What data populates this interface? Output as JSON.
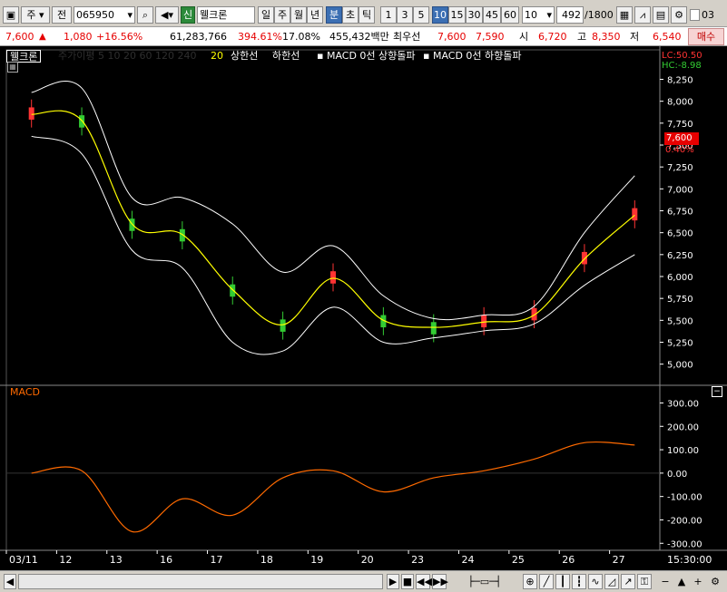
{
  "toolbar": {
    "market": "주",
    "prev_label": "전",
    "code": "065950",
    "badge": "신",
    "stock_name": "웰크론",
    "periods": [
      "일",
      "주",
      "월",
      "년",
      "분",
      "초",
      "틱"
    ],
    "active_period": "분",
    "intervals": [
      "1",
      "3",
      "5",
      "10",
      "15",
      "30",
      "45",
      "60"
    ],
    "active_interval": "10",
    "count_select": "10",
    "bar_count": "492",
    "bar_total": "/1800",
    "checkbox_label": "03"
  },
  "quote": {
    "price": "7,600",
    "change_arrow": "▲",
    "change": "1,080",
    "change_pct": "+16.56%",
    "volume": "61,283,766",
    "vol_ratio": "394.61%",
    "turnover": "17.08%",
    "amount": "455,432백만",
    "best_label": "최우선",
    "best_ask": "7,600",
    "best_bid": "7,590",
    "open_label": "시",
    "open": "6,720",
    "high_label": "고",
    "high": "8,350",
    "low_label": "저",
    "low": "6,540",
    "buy_button": "매수"
  },
  "legend": {
    "name_box": "웰크론",
    "faded_text": "주가이평 5 10 20 60 120 240",
    "ma_value": "20",
    "upper_band": "상한선",
    "lower_band": "하한선",
    "macd_up": "MACD 0선 상향돌파",
    "macd_down": "MACD 0선 하향돌파"
  },
  "price_panel": {
    "lc": "LC:50.50",
    "hc": "HC:-8.98",
    "current_price": "7,600",
    "current_pct": "0.40%",
    "y_ticks": [
      "8,250",
      "8,000",
      "7,750",
      "7,500",
      "7,250",
      "7,000",
      "6,750",
      "6,500",
      "6,250",
      "6,000",
      "5,750",
      "5,500",
      "5,250",
      "5,000"
    ]
  },
  "macd_panel": {
    "title": "MACD",
    "y_ticks": [
      "300.00",
      "200.00",
      "100.00",
      "0.00",
      "-100.00",
      "-200.00",
      "-300.00"
    ]
  },
  "x_axis": {
    "labels": [
      "03/11",
      "12",
      "13",
      "16",
      "17",
      "18",
      "19",
      "20",
      "23",
      "24",
      "25",
      "26",
      "27"
    ],
    "time": "15:30:00"
  },
  "colors": {
    "up": "#ff3333",
    "down": "#33cc33",
    "ma": "#ffff00",
    "band": "#ffffff",
    "macd": "#ff6a00"
  },
  "chart_data": [
    {
      "type": "line",
      "title": "웰크론",
      "x": [
        "03/11",
        "12",
        "13",
        "16",
        "17",
        "18",
        "19",
        "20",
        "23",
        "24",
        "25",
        "26",
        "27"
      ],
      "ylim": [
        4800,
        8400
      ],
      "series": [
        {
          "name": "20",
          "values": [
            7850,
            7780,
            6600,
            6480,
            5850,
            5450,
            5980,
            5500,
            5420,
            5480,
            5560,
            6200,
            6700
          ]
        },
        {
          "name": "상한선",
          "values": [
            8100,
            8150,
            6900,
            6900,
            6600,
            6050,
            6350,
            5780,
            5520,
            5560,
            5660,
            6500,
            7150
          ]
        },
        {
          "name": "하한선",
          "values": [
            7600,
            7400,
            6300,
            6100,
            5250,
            5150,
            5650,
            5250,
            5300,
            5380,
            5460,
            5900,
            6250
          ]
        }
      ]
    },
    {
      "type": "line",
      "title": "MACD",
      "x": [
        "03/11",
        "12",
        "13",
        "16",
        "17",
        "18",
        "19",
        "20",
        "23",
        "24",
        "25",
        "26",
        "27"
      ],
      "ylim": [
        -330,
        360
      ],
      "series": [
        {
          "name": "MACD",
          "values": [
            0,
            10,
            -250,
            -110,
            -180,
            -20,
            10,
            -80,
            -20,
            10,
            60,
            130,
            120
          ]
        }
      ]
    }
  ]
}
